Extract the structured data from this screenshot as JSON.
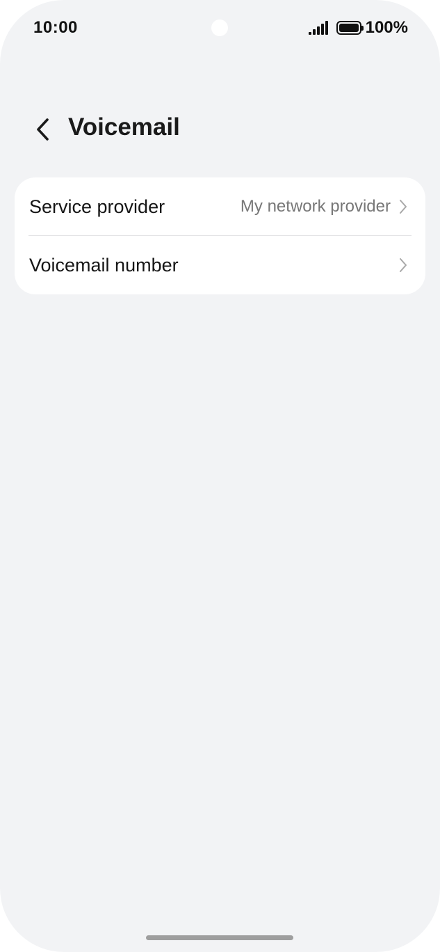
{
  "status_bar": {
    "time": "10:00",
    "battery": "100%",
    "signal_icon": "signal-bars-icon",
    "battery_icon": "battery-full-icon"
  },
  "header": {
    "title": "Voicemail",
    "back_icon": "chevron-left-icon"
  },
  "settings": {
    "items": [
      {
        "label": "Service provider",
        "value": "My network provider"
      },
      {
        "label": "Voicemail number",
        "value": ""
      }
    ]
  },
  "colors": {
    "background": "#f2f3f5",
    "card": "#ffffff",
    "text_primary": "#161616",
    "text_secondary": "#777777"
  }
}
